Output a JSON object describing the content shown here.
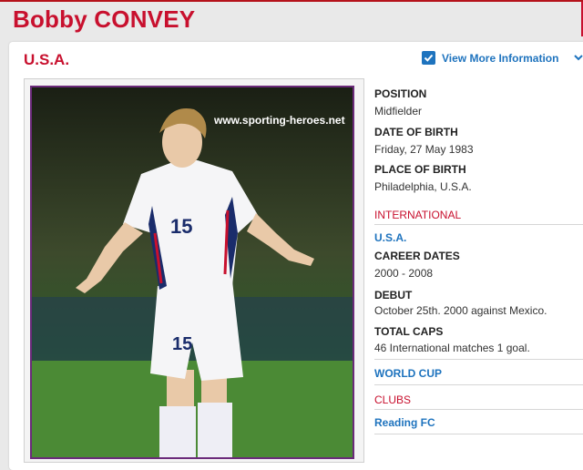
{
  "player": {
    "name": "Bobby CONVEY",
    "country": "U.S.A."
  },
  "header": {
    "view_more": "View More Information"
  },
  "photo": {
    "watermark": "www.sporting-heroes.net",
    "shirt_number": "15"
  },
  "details": {
    "position_label": "POSITION",
    "position_value": "Midfielder",
    "dob_label": "DATE OF BIRTH",
    "dob_value": "Friday, 27 May 1983",
    "pob_label": "PLACE OF BIRTH",
    "pob_value": "Philadelphia, U.S.A."
  },
  "international": {
    "heading": "INTERNATIONAL",
    "team": "U.S.A.",
    "career_dates_label": "CAREER DATES",
    "career_dates_value": "2000 - 2008",
    "debut_label": "DEBUT",
    "debut_value": "October 25th. 2000 against Mexico.",
    "total_caps_label": "TOTAL CAPS",
    "total_caps_value": "46 International matches 1 goal."
  },
  "world_cup": {
    "label": "WORLD CUP"
  },
  "clubs": {
    "heading": "CLUBS",
    "items": [
      "Reading FC"
    ]
  },
  "colors": {
    "accent_red": "#c8102e",
    "link_blue": "#1e73be",
    "frame_purple": "#6b2a7a"
  },
  "icons": [
    "checkbox-checked-icon",
    "chevron-down-icon"
  ]
}
